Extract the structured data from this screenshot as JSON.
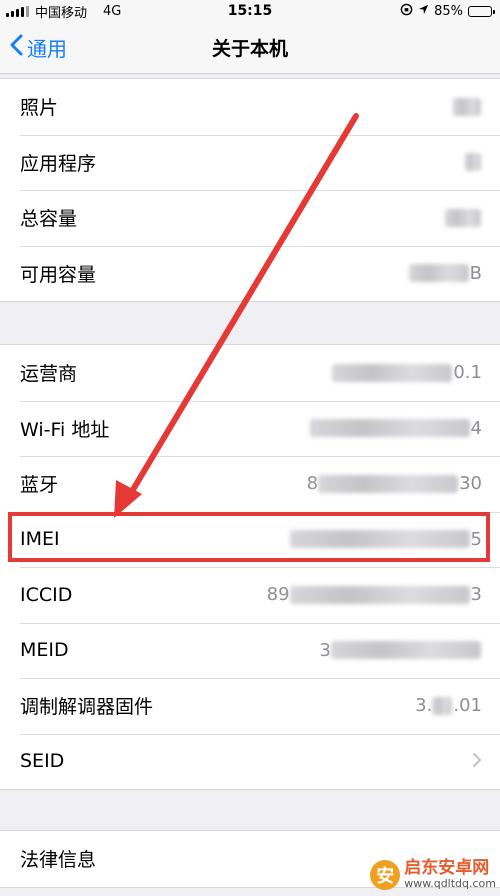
{
  "status_bar": {
    "carrier": "中国移动",
    "network": "4G",
    "time": "15:15",
    "battery_percent": "85%",
    "battery_level": 0.85
  },
  "nav": {
    "back_label": "通用",
    "title": "关于本机"
  },
  "group1": [
    {
      "label": "照片",
      "value": "",
      "trailing": ""
    },
    {
      "label": "应用程序",
      "value": "",
      "trailing": ""
    },
    {
      "label": "总容量",
      "value": "",
      "trailing": ""
    },
    {
      "label": "可用容量",
      "value": "",
      "trailing": "B"
    }
  ],
  "group2": [
    {
      "label": "运营商",
      "prefix": "",
      "trailing": "0.1"
    },
    {
      "label": "Wi-Fi 地址",
      "prefix": "",
      "trailing": "4"
    },
    {
      "label": "蓝牙",
      "prefix": "8",
      "trailing": "30"
    },
    {
      "label": "IMEI",
      "prefix": "",
      "trailing": "5"
    },
    {
      "label": "ICCID",
      "prefix": "89",
      "trailing": "3"
    },
    {
      "label": "MEID",
      "prefix": "3",
      "trailing": ""
    },
    {
      "label": "调制解调器固件",
      "prefix": "3.",
      "trailing": ".01"
    },
    {
      "label": "SEID",
      "prefix": "",
      "trailing": ""
    }
  ],
  "group3": [
    {
      "label": "法律信息"
    }
  ],
  "watermark": {
    "logo_glyph": "安",
    "name": "启东安卓网",
    "url": "www.qdltdq.com"
  },
  "colors": {
    "accent": "#147efb",
    "highlight": "#e53935"
  },
  "icons": {
    "back": "chevron-left-icon",
    "disclosure": "chevron-right-icon",
    "location": "location-arrow-icon",
    "lock": "rotation-lock-icon"
  }
}
